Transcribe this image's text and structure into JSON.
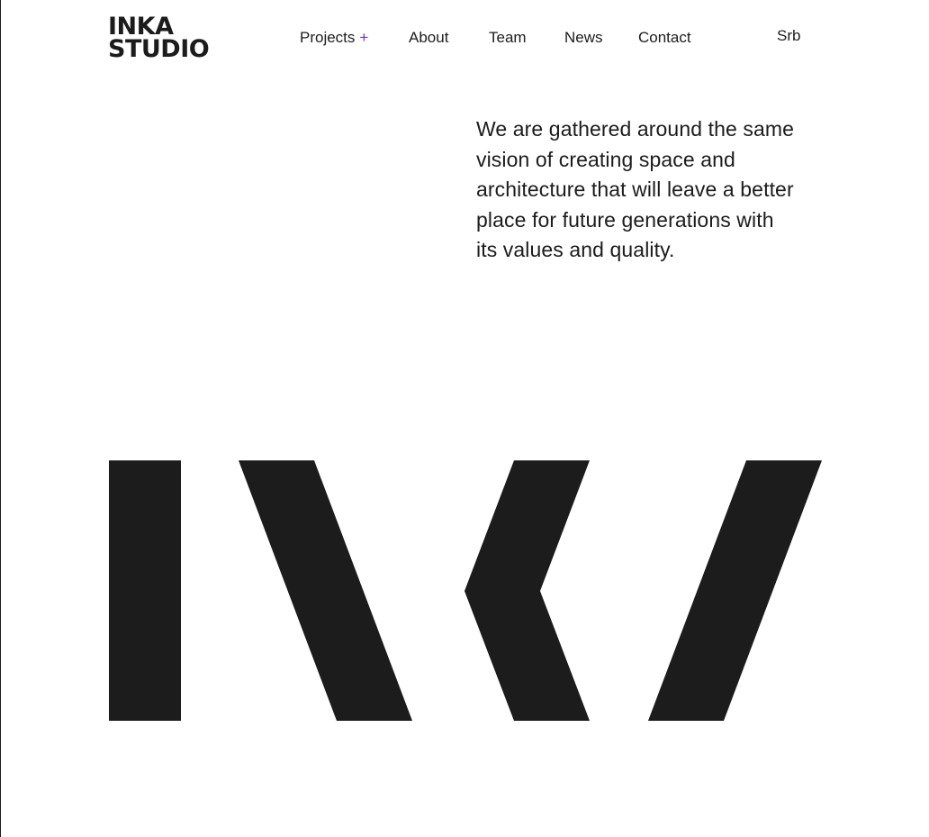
{
  "brand": {
    "line1": "INKA",
    "line2": "STUDIO"
  },
  "nav": {
    "projects": "Projects",
    "projects_suffix": "+",
    "about": "About",
    "team": "Team",
    "news": "News",
    "contact": "Contact"
  },
  "language": {
    "label": "Srb"
  },
  "intro": {
    "text": "We are gathered around the same vision of creating space and architecture that will leave a better place for future generations with its values and quality."
  },
  "colors": {
    "ink": "#1c1c1c",
    "accent": "#6a2cf5",
    "background": "#ffffff"
  }
}
